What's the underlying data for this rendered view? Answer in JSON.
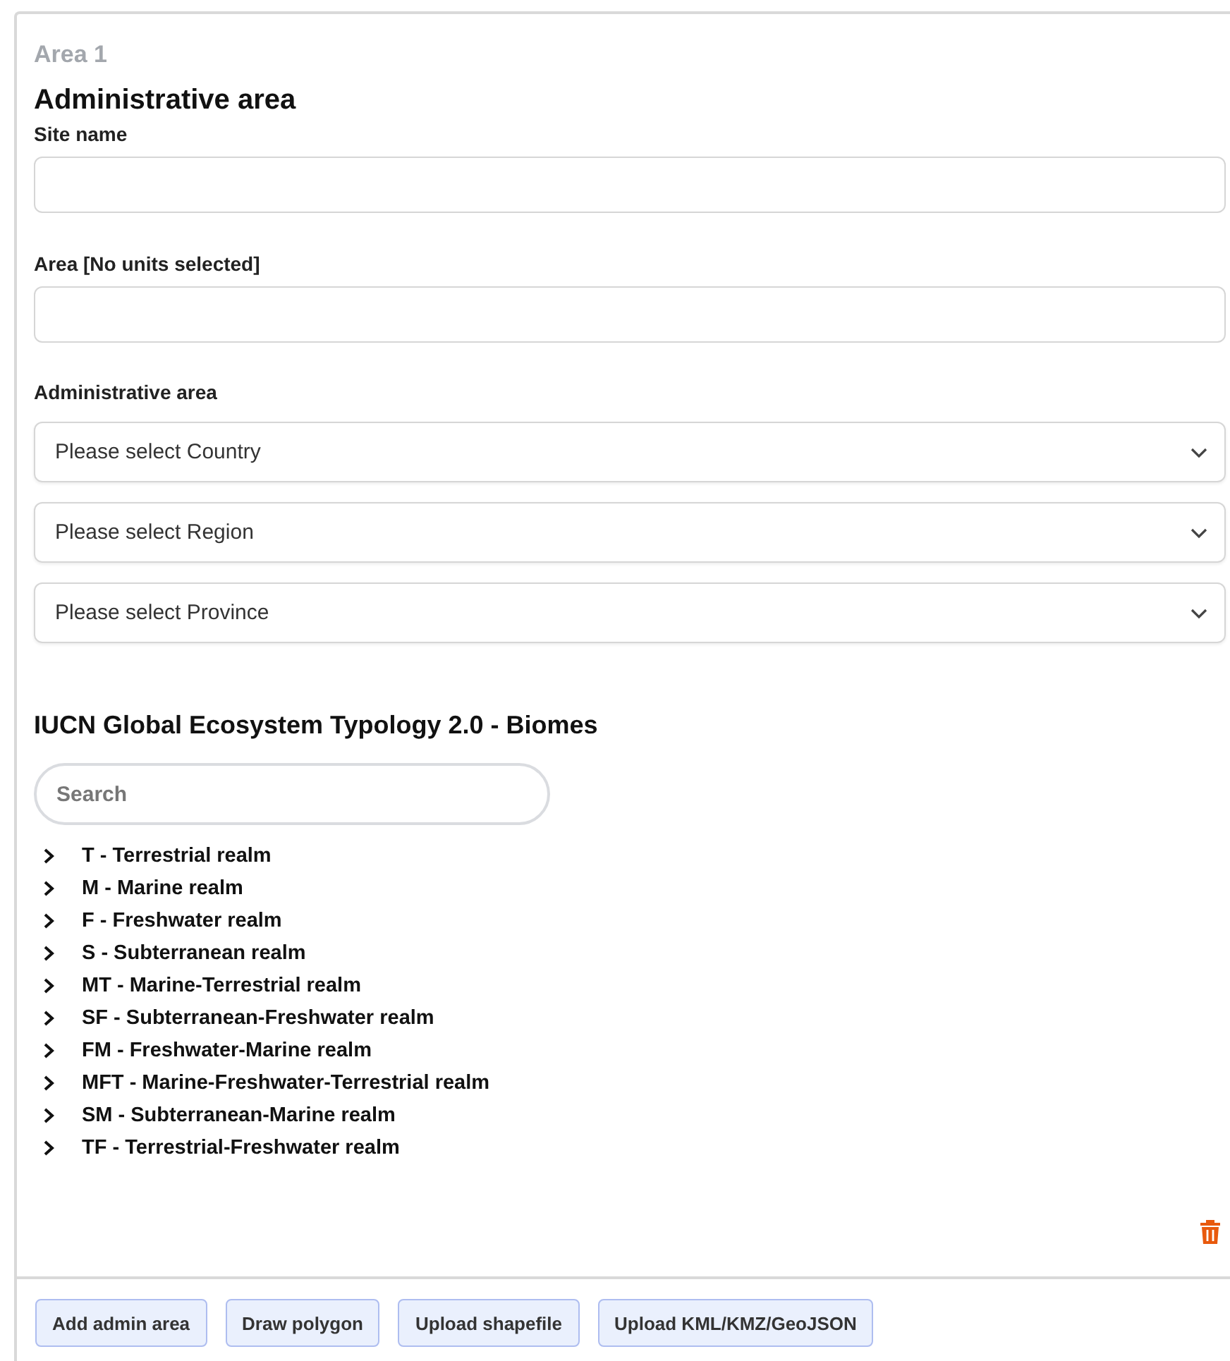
{
  "area_label": "Area 1",
  "title": "Administrative area",
  "fields": [
    {
      "label": "Site name"
    },
    {
      "label": "Area [No units selected]"
    }
  ],
  "admin_area": {
    "label": "Administrative area",
    "selects": [
      {
        "placeholder": "Please select Country"
      },
      {
        "placeholder": "Please select Region"
      },
      {
        "placeholder": "Please select Province"
      }
    ]
  },
  "biomes": {
    "heading": "IUCN Global Ecosystem Typology 2.0 - Biomes",
    "search": {
      "placeholder": "Search"
    },
    "items": [
      {
        "label": "T - Terrestrial realm",
        "expanded": false
      },
      {
        "label": "M - Marine realm",
        "expanded": false
      },
      {
        "label": "F - Freshwater realm",
        "expanded": false
      },
      {
        "label": "S - Subterranean realm",
        "expanded": false
      },
      {
        "label": "MT - Marine-Terrestrial realm",
        "expanded": false
      },
      {
        "label": "SF - Subterranean-Freshwater realm",
        "expanded": false
      },
      {
        "label": "FM - Freshwater-Marine realm",
        "expanded": false
      },
      {
        "label": "MFT - Marine-Freshwater-Terrestrial realm",
        "expanded": false
      },
      {
        "label": "SM - Subterranean-Marine realm",
        "expanded": false
      },
      {
        "label": "TF - Terrestrial-Freshwater realm",
        "expanded": false
      }
    ]
  },
  "buttons": [
    "Add admin area",
    "Draw polygon",
    "Upload shapefile",
    "Upload KML/KMZ/GeoJSON"
  ]
}
